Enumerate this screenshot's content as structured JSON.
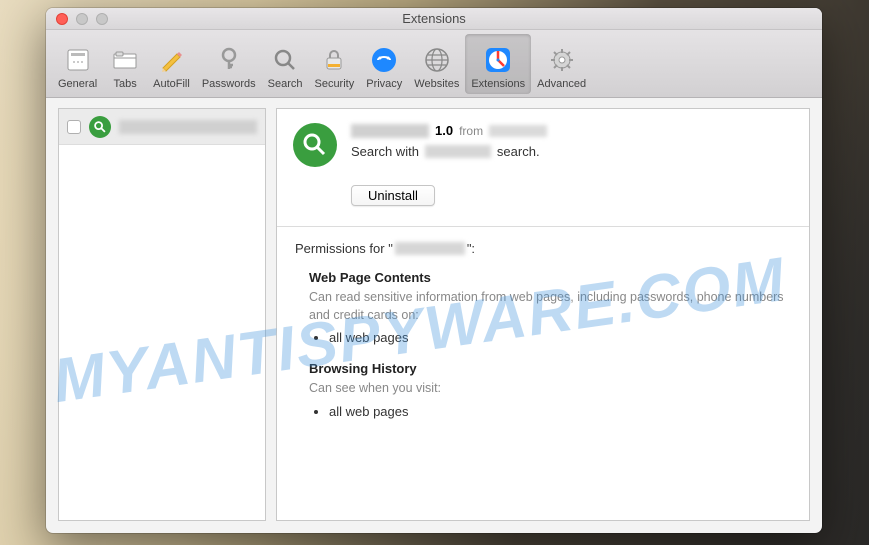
{
  "window": {
    "title": "Extensions"
  },
  "toolbar": {
    "items": [
      {
        "label": "General",
        "icon": "general"
      },
      {
        "label": "Tabs",
        "icon": "tabs"
      },
      {
        "label": "AutoFill",
        "icon": "autofill"
      },
      {
        "label": "Passwords",
        "icon": "passwords"
      },
      {
        "label": "Search",
        "icon": "search"
      },
      {
        "label": "Security",
        "icon": "security"
      },
      {
        "label": "Privacy",
        "icon": "privacy"
      },
      {
        "label": "Websites",
        "icon": "websites"
      },
      {
        "label": "Extensions",
        "icon": "extensions"
      },
      {
        "label": "Advanced",
        "icon": "advanced"
      }
    ],
    "active_index": 8
  },
  "sidebar": {
    "items": [
      {
        "name_redacted": true,
        "checked": false
      }
    ]
  },
  "detail": {
    "name_redacted": true,
    "version": "1.0",
    "from_label": "from",
    "from_redacted": true,
    "description_prefix": "Search with",
    "description_mid_redacted": true,
    "description_suffix": "search.",
    "uninstall_label": "Uninstall"
  },
  "permissions": {
    "title_prefix": "Permissions for \"",
    "title_name_redacted": true,
    "title_suffix": "\":",
    "sections": [
      {
        "heading": "Web Page Contents",
        "description": "Can read sensitive information from web pages, including passwords, phone numbers and credit cards on:",
        "items": [
          "all web pages"
        ]
      },
      {
        "heading": "Browsing History",
        "description": "Can see when you visit:",
        "items": [
          "all web pages"
        ]
      }
    ]
  },
  "watermark": "MYANTISPYWARE.COM"
}
